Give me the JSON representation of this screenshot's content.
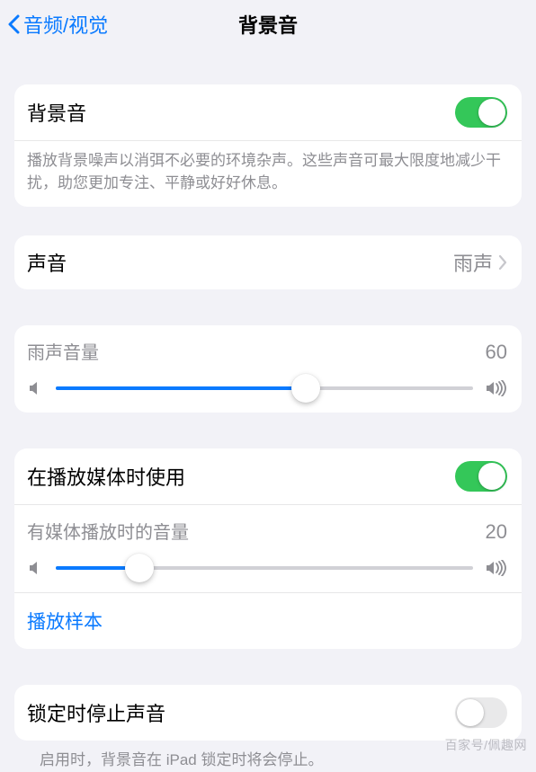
{
  "nav": {
    "back_label": "音频/视觉",
    "title": "背景音"
  },
  "section_main": {
    "toggle_label": "背景音",
    "toggle_on": true,
    "description": "播放背景噪声以消弭不必要的环境杂声。这些声音可最大限度地减少干扰，助您更加专注、平静或好好休息。"
  },
  "section_sound": {
    "label": "声音",
    "value": "雨声"
  },
  "section_volume": {
    "label": "雨声音量",
    "value": 60
  },
  "section_media": {
    "toggle_label": "在播放媒体时使用",
    "toggle_on": true,
    "volume_label": "有媒体播放时的音量",
    "volume_value": 20,
    "sample_label": "播放样本"
  },
  "section_lock": {
    "toggle_label": "锁定时停止声音",
    "toggle_on": false,
    "description": "启用时，背景音在 iPad 锁定时将会停止。"
  },
  "watermark": "百家号/佩趣网"
}
